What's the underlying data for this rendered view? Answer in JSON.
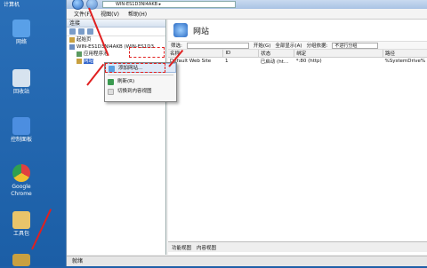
{
  "desktop": {
    "top_label": "计算机",
    "icons": [
      {
        "label": "网络",
        "color": "#59a0e8"
      },
      {
        "label": "回收站",
        "color": "#d7e3ef"
      },
      {
        "label": "控制面板",
        "color": "#4c8ee0"
      },
      {
        "label": "Google Chrome",
        "color": "#e9b24a"
      },
      {
        "label": "工具包",
        "color": "#e8c46a"
      }
    ]
  },
  "window": {
    "address": "WIN-ES1D3NI4AKB ▸",
    "menu": [
      "文件(F)",
      "视图(V)",
      "帮助(H)"
    ]
  },
  "left": {
    "header": "连接",
    "tree": [
      {
        "text": "起始页"
      },
      {
        "text": "WIN-ES1D3NI4AKB (WIN-ES1D3"
      },
      {
        "text": "应用程序池"
      },
      {
        "text": "网站"
      }
    ]
  },
  "context_menu": {
    "items": [
      "添加网站...",
      "刷新(R)",
      "切换到内容视图"
    ]
  },
  "right": {
    "title": "网站",
    "filter_label": "筛选:",
    "go_label": "开始(G)",
    "show_all": "全部显示(A)",
    "group_label": "分组依据:",
    "group_value": "不进行分组",
    "columns": [
      "名称",
      "ID",
      "状态",
      "绑定",
      "路径"
    ],
    "rows": [
      [
        "Default Web Site",
        "1",
        "已启动 (ht...",
        "*:80 (http)",
        "%SystemDrive%"
      ]
    ]
  },
  "tabs": {
    "features": "功能视图",
    "content": "内容视图"
  },
  "status": "就绪"
}
